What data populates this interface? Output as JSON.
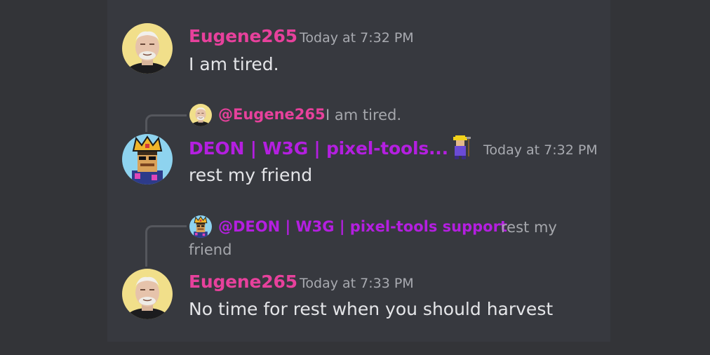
{
  "colors": {
    "page_bg": "#333438",
    "panel_bg": "#37393f",
    "username_pink": "#e7419c",
    "username_purple": "#b41fe0",
    "timestamp": "#a8aab0",
    "message_text": "#e4e5e8"
  },
  "messages": [
    {
      "author": "Eugene265",
      "timestamp": "Today at 7:32 PM",
      "content": "I am tired.",
      "avatar_icon": "old-man-avatar-icon"
    },
    {
      "reply": {
        "mention": "@Eugene265",
        "preview": "I am tired.",
        "avatar_icon": "old-man-avatar-icon"
      },
      "author": "DEON | W3G | pixel-tools...",
      "badge_icon": "farmer-emoji-icon",
      "timestamp": "Today at 7:32 PM",
      "content": "rest my friend",
      "avatar_icon": "pixel-king-avatar-icon"
    },
    {
      "reply": {
        "mention": "@DEON | W3G | pixel-tools support",
        "preview_line1": "rest my",
        "preview_line2": "friend",
        "avatar_icon": "pixel-king-avatar-icon"
      },
      "author": "Eugene265",
      "timestamp": "Today at 7:33 PM",
      "content": "No time for rest when you should harvest",
      "avatar_icon": "old-man-avatar-icon"
    }
  ]
}
